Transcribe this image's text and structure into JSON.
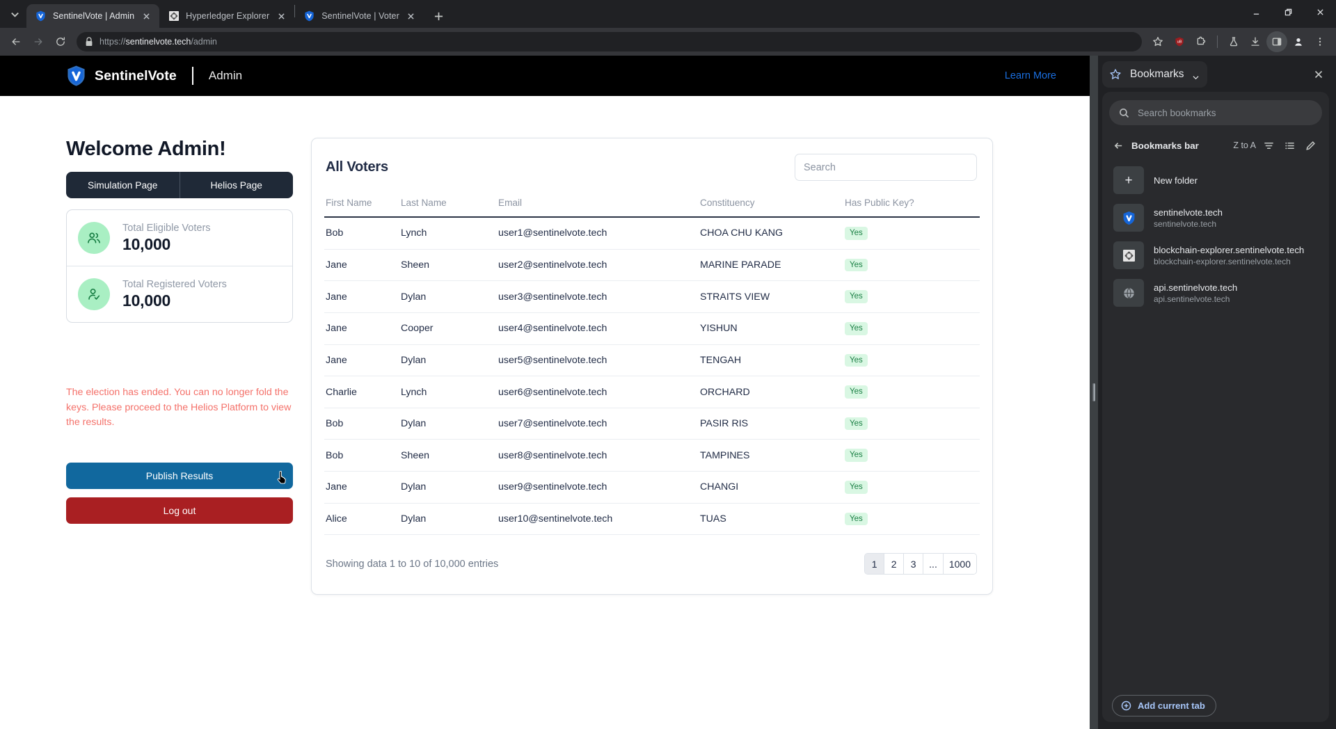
{
  "browser": {
    "tab_search_icon": "chevron-down-icon",
    "tabs": [
      {
        "title": "SentinelVote | Admin",
        "favicon": "sentinelvote-shield-icon",
        "active": true
      },
      {
        "title": "Hyperledger Explorer",
        "favicon": "hyperledger-icon",
        "active": false
      },
      {
        "title": "SentinelVote | Voter",
        "favicon": "sentinelvote-shield-icon",
        "active": false
      }
    ],
    "new_tab_label": "+",
    "window_controls": [
      "minimize",
      "restore",
      "close"
    ],
    "nav": {
      "back": "back-arrow-icon",
      "forward": "forward-arrow-icon",
      "reload": "reload-icon"
    },
    "omnibox": {
      "lock_icon": "https-lock-icon",
      "url_scheme": "https://",
      "url_host": "sentinelvote.tech",
      "url_path": "/admin",
      "full_url": "https://sentinelvote.tech/admin"
    },
    "toolbar_icons": [
      "bookmark-star-icon",
      "ublock-origin-icon",
      "extensions-icon",
      "flask-icon",
      "downloads-icon",
      "side-panel-icon",
      "profile-avatar-icon",
      "three-dot-menu-icon"
    ],
    "ublock_badge": "10"
  },
  "site": {
    "brand_name": "SentinelVote",
    "brand_section": "Admin",
    "learn_more": "Learn More"
  },
  "left": {
    "welcome": "Welcome Admin!",
    "tabs": [
      {
        "label": "Simulation Page"
      },
      {
        "label": "Helios Page"
      }
    ],
    "stats": [
      {
        "icon": "users-group-icon",
        "label": "Total Eligible Voters",
        "value": "10,000"
      },
      {
        "icon": "user-check-icon",
        "label": "Total Registered Voters",
        "value": "10,000"
      }
    ],
    "warning": "The election has ended. You can no longer fold the keys. Please proceed to the Helios Platform to view the results.",
    "publish_label": "Publish Results",
    "logout_label": "Log out"
  },
  "table": {
    "title": "All Voters",
    "search_placeholder": "Search",
    "search_value": "",
    "columns": [
      "First Name",
      "Last Name",
      "Email",
      "Constituency",
      "Has Public Key?"
    ],
    "rows": [
      {
        "first": "Bob",
        "last": "Lynch",
        "email": "user1@sentinelvote.tech",
        "constituency": "CHOA CHU KANG",
        "haskey": "Yes"
      },
      {
        "first": "Jane",
        "last": "Sheen",
        "email": "user2@sentinelvote.tech",
        "constituency": "MARINE PARADE",
        "haskey": "Yes"
      },
      {
        "first": "Jane",
        "last": "Dylan",
        "email": "user3@sentinelvote.tech",
        "constituency": "STRAITS VIEW",
        "haskey": "Yes"
      },
      {
        "first": "Jane",
        "last": "Cooper",
        "email": "user4@sentinelvote.tech",
        "constituency": "YISHUN",
        "haskey": "Yes"
      },
      {
        "first": "Jane",
        "last": "Dylan",
        "email": "user5@sentinelvote.tech",
        "constituency": "TENGAH",
        "haskey": "Yes"
      },
      {
        "first": "Charlie",
        "last": "Lynch",
        "email": "user6@sentinelvote.tech",
        "constituency": "ORCHARD",
        "haskey": "Yes"
      },
      {
        "first": "Bob",
        "last": "Dylan",
        "email": "user7@sentinelvote.tech",
        "constituency": "PASIR RIS",
        "haskey": "Yes"
      },
      {
        "first": "Bob",
        "last": "Sheen",
        "email": "user8@sentinelvote.tech",
        "constituency": "TAMPINES",
        "haskey": "Yes"
      },
      {
        "first": "Jane",
        "last": "Dylan",
        "email": "user9@sentinelvote.tech",
        "constituency": "CHANGI",
        "haskey": "Yes"
      },
      {
        "first": "Alice",
        "last": "Dylan",
        "email": "user10@sentinelvote.tech",
        "constituency": "TUAS",
        "haskey": "Yes"
      }
    ],
    "showing": "Showing data 1 to 10 of 10,000 entries",
    "pagination": [
      {
        "label": "1",
        "current": true
      },
      {
        "label": "2",
        "current": false
      },
      {
        "label": "3",
        "current": false
      },
      {
        "label": "...",
        "current": false
      },
      {
        "label": "1000",
        "current": false
      }
    ]
  },
  "sidepanel": {
    "title": "Bookmarks",
    "close_icon": "close-icon",
    "search_placeholder": "Search bookmarks",
    "search_value": "",
    "breadcrumb": "Bookmarks bar",
    "sort_label": "Z to A",
    "sort_icon": "sort-filter-icon",
    "view_icon": "list-view-icon",
    "edit_icon": "pencil-edit-icon",
    "items": [
      {
        "name": "New folder",
        "url": "",
        "icon": "plus-icon"
      },
      {
        "name": "sentinelvote.tech",
        "url": "sentinelvote.tech",
        "icon": "sentinelvote-shield-icon"
      },
      {
        "name": "blockchain-explorer.sentinelvote.tech",
        "url": "blockchain-explorer.sentinelvote.tech",
        "icon": "hyperledger-icon"
      },
      {
        "name": "api.sentinelvote.tech",
        "url": "api.sentinelvote.tech",
        "icon": "globe-icon"
      }
    ],
    "add_current_tab": "Add current tab"
  },
  "colors": {
    "brand_blue": "#1a6fe0",
    "publish_blue": "#11689e",
    "logout_red": "#a91f22",
    "warning_red": "#f4716a",
    "badge_green_bg": "#d9f7e3",
    "badge_green_text": "#1a7f44",
    "stat_circle": "#a9efc3"
  }
}
